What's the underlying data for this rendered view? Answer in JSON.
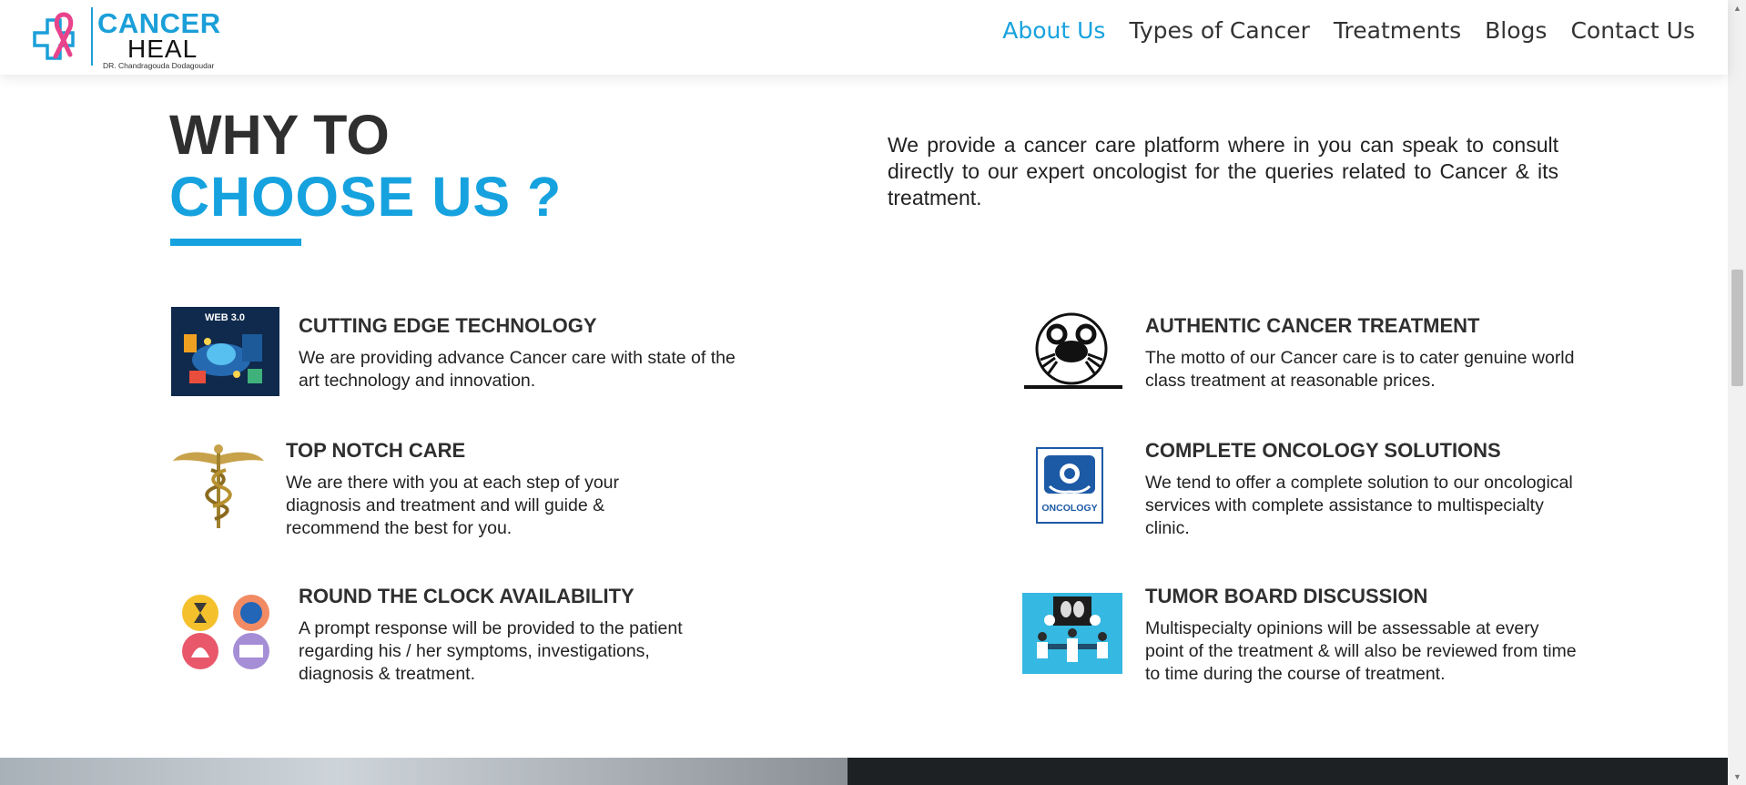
{
  "logo": {
    "brand_top": "CANCER",
    "brand_bottom": "HEAL",
    "subtitle": "DR. Chandragouda Dodagoudar"
  },
  "nav": [
    {
      "label": "About Us",
      "active": true
    },
    {
      "label": "Types of Cancer"
    },
    {
      "label": "Treatments"
    },
    {
      "label": "Blogs"
    },
    {
      "label": "Contact Us"
    }
  ],
  "section": {
    "heading_line1": "WHY TO",
    "heading_line2": "CHOOSE US ?",
    "intro": "We provide a cancer care platform where in you can speak to consult directly to our expert oncologist for the queries related to Cancer & its treatment."
  },
  "features": [
    {
      "title": "CUTTING EDGE TECHNOLOGY",
      "desc": "We are providing advance Cancer care with state of the art technology and innovation.",
      "image_text": "WEB 3.0"
    },
    {
      "title": "AUTHENTIC CANCER TREATMENT",
      "desc": "The motto of our Cancer care is to cater genuine world class treatment at reasonable prices."
    },
    {
      "title": "TOP NOTCH CARE",
      "desc": "We are there with you at each step of your diagnosis and treatment and will guide & recommend the best for you."
    },
    {
      "title": "COMPLETE ONCOLOGY SOLUTIONS",
      "desc": "We tend to offer a complete solution to our oncological services with complete assistance to multispecialty clinic.",
      "image_text": "ONCOLOGY"
    },
    {
      "title": "ROUND THE CLOCK AVAILABILITY",
      "desc": "A prompt response will be provided to the patient regarding his / her symptoms, investigations, diagnosis & treatment."
    },
    {
      "title": "TUMOR BOARD DISCUSSION",
      "desc": "Multispecialty opinions will be assessable at every point of the treatment & will also be reviewed from time to time during the course of treatment."
    }
  ],
  "colors": {
    "accent": "#16a2de",
    "heading": "#2f2f2f",
    "logo_pink": "#e8438b"
  }
}
